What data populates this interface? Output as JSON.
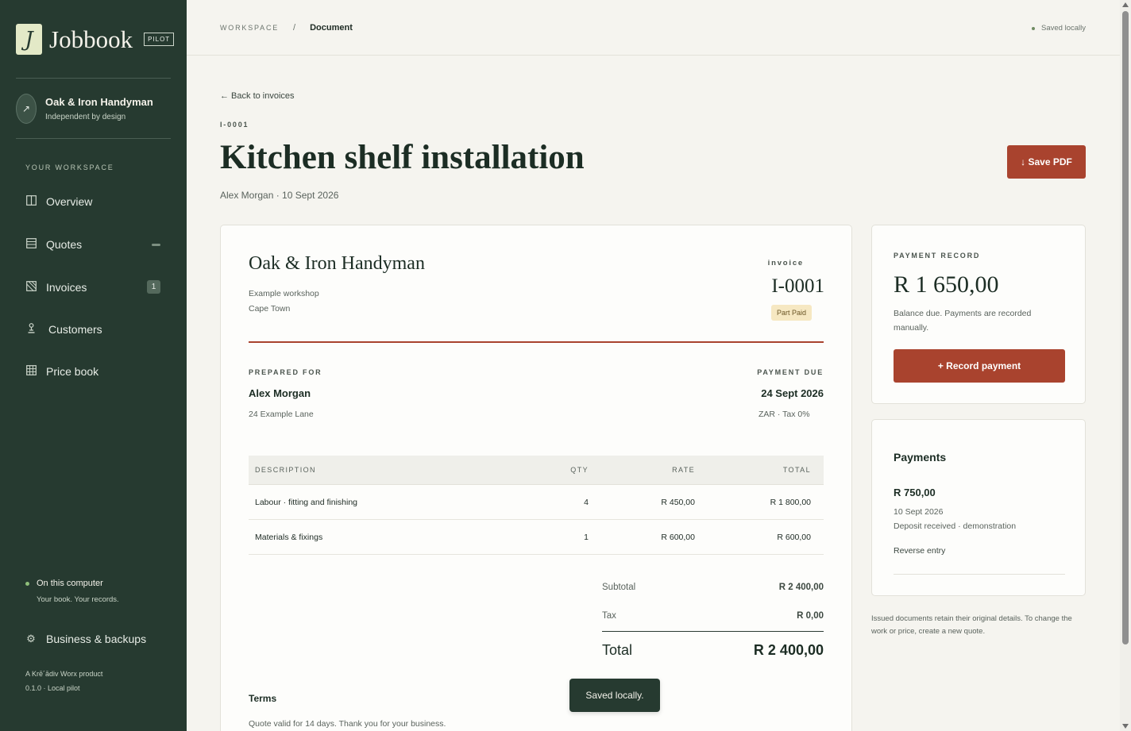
{
  "brand": {
    "logo_letter": "J",
    "name": "Jobbook",
    "badge": "PILOT"
  },
  "business": {
    "avatar_icon": "↗",
    "name": "Oak & Iron Handyman",
    "tagline": "Independent by design"
  },
  "sidebar": {
    "section_label": "YOUR WORKSPACE",
    "items": [
      {
        "label": "Overview",
        "icon": "columns-icon"
      },
      {
        "label": "Quotes",
        "icon": "document-lines-icon"
      },
      {
        "label": "Invoices",
        "icon": "invoice-hatched-icon",
        "count": "1"
      },
      {
        "label": "Customers",
        "icon": "person-icon"
      },
      {
        "label": "Price book",
        "icon": "grid-icon"
      }
    ],
    "local": {
      "title": "On this computer",
      "subtitle": "Your book. Your records."
    },
    "backups_label": "Business & backups",
    "footer_line1": "A Krē´ādiv Worx product",
    "footer_line2": "0.1.0 · Local pilot"
  },
  "topbar": {
    "breadcrumb_root": "WORKSPACE",
    "separator": "/",
    "breadcrumb_current": "Document",
    "saved_status": "Saved locally"
  },
  "header": {
    "back_link": "← Back to invoices",
    "doc_number": "I-0001",
    "title": "Kitchen shelf installation",
    "subtitle": "Alex Morgan · 10 Sept 2026",
    "save_pdf": "↓ Save PDF"
  },
  "document": {
    "business_name": "Oak & Iron Handyman",
    "address_line1": "Example workshop",
    "address_line2": "Cape Town",
    "kind": "invoice",
    "number": "I-0001",
    "status": "Part Paid",
    "prepared_for_label": "PREPARED FOR",
    "client_name": "Alex Morgan",
    "client_address": "24 Example Lane",
    "payment_due_label": "PAYMENT DUE",
    "due_date": "24 Sept 2026",
    "currency_tax": "ZAR · Tax 0%",
    "columns": [
      "DESCRIPTION",
      "QTY",
      "RATE",
      "TOTAL"
    ],
    "items": [
      {
        "description": "Labour · fitting and finishing",
        "qty": "4",
        "rate": "R 450,00",
        "total": "R 1 800,00"
      },
      {
        "description": "Materials & fixings",
        "qty": "1",
        "rate": "R 600,00",
        "total": "R 600,00"
      }
    ],
    "subtotal_label": "Subtotal",
    "subtotal": "R 2 400,00",
    "tax_label": "Tax",
    "tax": "R 0,00",
    "total_label": "Total",
    "total": "R 2 400,00",
    "terms_label": "Terms",
    "terms_text": "Quote valid for 14 days. Thank you for your business."
  },
  "payment_record": {
    "label": "PAYMENT RECORD",
    "balance": "R 1 650,00",
    "note": "Balance due. Payments are recorded manually.",
    "button": "+ Record payment"
  },
  "payments": {
    "title": "Payments",
    "entries": [
      {
        "amount": "R 750,00",
        "date": "10 Sept 2026",
        "description": "Deposit received · demonstration",
        "action": "Reverse entry"
      }
    ]
  },
  "side_note": "Issued documents retain their original details. To change the work or price, create a new quote.",
  "toast": "Saved locally.",
  "colors": {
    "sidebar": "#263a30",
    "accent": "#a9432e",
    "background": "#f5f4ef",
    "status_bg": "#f6e8c2"
  }
}
